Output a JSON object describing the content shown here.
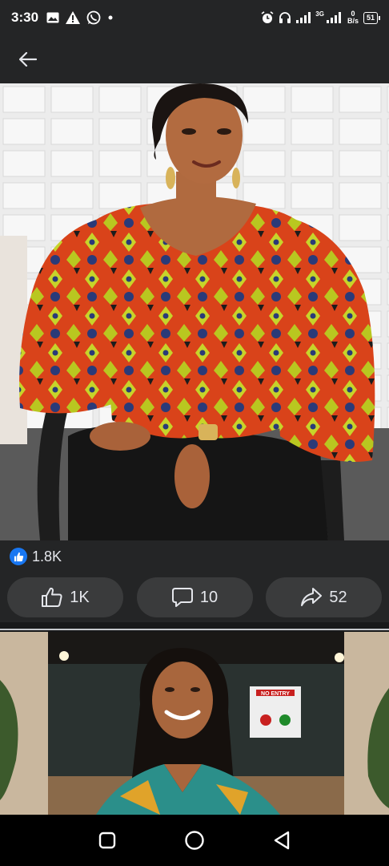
{
  "status_bar": {
    "time": "3:30",
    "network_label": "3G",
    "net_speed_value": "0",
    "net_speed_unit": "B/s",
    "battery": "51"
  },
  "app_bar": {
    "back_icon": "arrow-left-icon"
  },
  "post": {
    "reaction_icon": "like-icon",
    "reaction_count": "1.8K",
    "actions": {
      "like": {
        "icon": "thumbs-up-icon",
        "label": "1K"
      },
      "comment": {
        "icon": "comment-icon",
        "label": "10"
      },
      "share": {
        "icon": "share-icon",
        "label": "52"
      }
    }
  },
  "post2": {
    "sign_text": "NO ENTRY"
  },
  "nav": {
    "recents": "square-icon",
    "home": "circle-icon",
    "back": "triangle-back-icon"
  },
  "colors": {
    "surface": "#242526",
    "background": "#18191a",
    "button": "#3a3b3c",
    "accent": "#1877f2",
    "text": "#e4e6eb"
  }
}
